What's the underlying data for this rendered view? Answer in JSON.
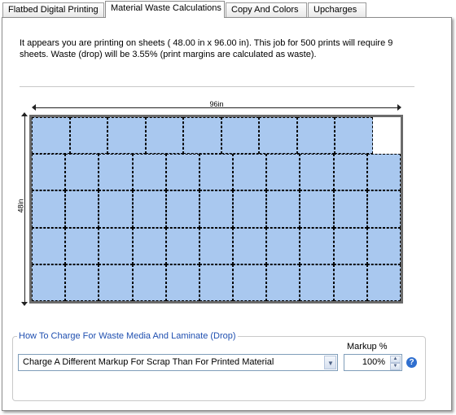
{
  "tabs": [
    {
      "label": "Flatbed Digital Printing",
      "active": false
    },
    {
      "label": "Material Waste Calculations",
      "active": true
    },
    {
      "label": "Copy And Colors",
      "active": false
    },
    {
      "label": "Upcharges",
      "active": false
    }
  ],
  "message": {
    "line1": "It appears you are printing on sheets (   48.00 in x    96.00 in).  This job for 500 prints will require 9",
    "line2": "sheets.  Waste (drop) will be 3.55% (print margins are calculated as waste)."
  },
  "sheet_diagram": {
    "width_label": "96in",
    "height_label": "48in",
    "rows": [
      {
        "cells": 10,
        "filled": 9
      },
      {
        "cells": 11,
        "filled": 11
      },
      {
        "cells": 11,
        "filled": 11
      },
      {
        "cells": 11,
        "filled": 11
      },
      {
        "cells": 11,
        "filled": 11
      }
    ],
    "print_color": "#a9c8ef",
    "sheet_border_color": "#6b6b6b"
  },
  "waste_charge": {
    "group_title": "How To Charge For Waste Media And Laminate (Drop)",
    "method_value": "Charge A Different Markup For Scrap Than For Printed Material",
    "markup_label": "Markup %",
    "markup_value": "100%",
    "help_glyph": "?"
  },
  "icons": {
    "dropdown": "chevron-down-icon",
    "spin_up": "spin-up-icon",
    "spin_down": "spin-down-icon",
    "help": "help-icon"
  },
  "colors": {
    "group_title": "#1f4fb0",
    "help_icon": "#2f6fcf"
  }
}
